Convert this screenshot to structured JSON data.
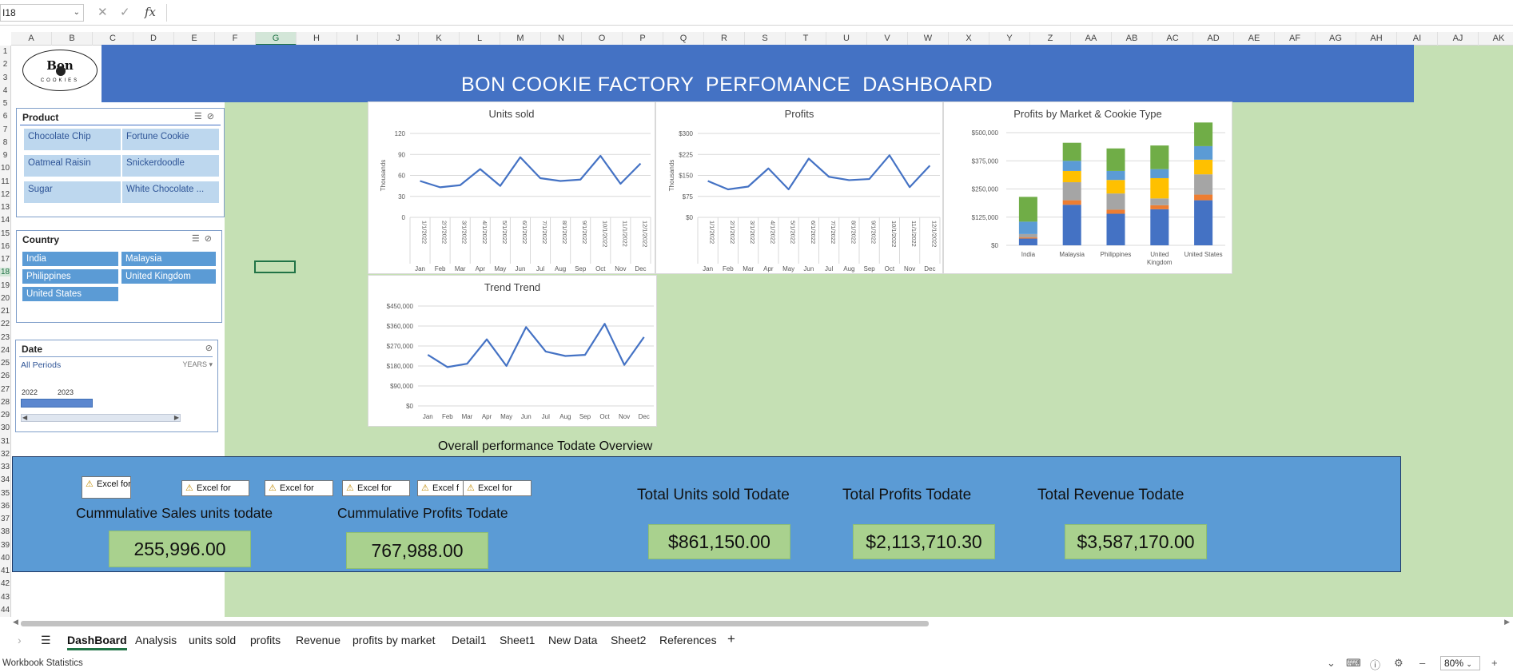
{
  "formula_bar": {
    "name_box": "I18",
    "cancel_icon": "cancel-icon",
    "enter_icon": "check-icon",
    "fx_label": "fx",
    "content": ""
  },
  "columns": [
    "A",
    "B",
    "C",
    "D",
    "E",
    "F",
    "G",
    "H",
    "I",
    "J",
    "K",
    "L",
    "M",
    "N",
    "O",
    "P",
    "Q",
    "R",
    "S",
    "T",
    "U",
    "V",
    "W",
    "X",
    "Y",
    "Z",
    "AA",
    "AB",
    "AC",
    "AD",
    "AE",
    "AF",
    "AG",
    "AH",
    "AI",
    "AJ",
    "AK"
  ],
  "rows": [
    "1",
    "2",
    "3",
    "4",
    "5",
    "6",
    "7",
    "8",
    "9",
    "10",
    "11",
    "12",
    "13",
    "14",
    "15",
    "16",
    "17",
    "18",
    "19",
    "20",
    "21",
    "22",
    "23",
    "24",
    "25",
    "26",
    "27",
    "28",
    "29",
    "30",
    "31",
    "32",
    "33",
    "34",
    "35",
    "36",
    "37",
    "38",
    "39",
    "40",
    "41",
    "42",
    "43",
    "44"
  ],
  "banner": {
    "title": "BON COOKIE FACTORY  PERFOMANCE  DASHBOARD"
  },
  "logo": {
    "line1": "Bon",
    "line2": "COOKIES"
  },
  "slicers": {
    "product": {
      "title": "Product",
      "items": [
        "Chocolate Chip",
        "Fortune Cookie",
        "Oatmeal Raisin",
        "Snickerdoodle",
        "Sugar",
        "White Chocolate ..."
      ]
    },
    "country": {
      "title": "Country",
      "items": [
        "India",
        "Malaysia",
        "Philippines",
        "United Kingdom",
        "United States"
      ]
    },
    "date": {
      "title": "Date",
      "periods": "All Periods",
      "level": "YEARS",
      "years": [
        "2022",
        "2023"
      ]
    }
  },
  "charts": {
    "months": [
      "Jan",
      "Feb",
      "Mar",
      "Apr",
      "May",
      "Jun",
      "Jul",
      "Aug",
      "Sep",
      "Oct",
      "Nov",
      "Dec"
    ],
    "dates": [
      "1/1/2022",
      "2/1/2022",
      "3/1/2022",
      "4/1/2022",
      "5/1/2022",
      "6/1/2022",
      "7/1/2022",
      "8/1/2022",
      "9/1/2022",
      "10/1/2022",
      "11/1/2022",
      "12/1/2022"
    ]
  },
  "chart_data": [
    {
      "type": "line",
      "title": "Units sold",
      "ylabel": "Thousands",
      "x": [
        "Jan",
        "Feb",
        "Mar",
        "Apr",
        "May",
        "Jun",
        "Jul",
        "Aug",
        "Sep",
        "Oct",
        "Nov",
        "Dec"
      ],
      "values": [
        52,
        43,
        46,
        69,
        45,
        86,
        56,
        52,
        54,
        88,
        48,
        77
      ],
      "ylim": [
        0,
        120
      ],
      "yticks": [
        "0",
        "30",
        "60",
        "90",
        "120"
      ],
      "color": "#4472c4"
    },
    {
      "type": "line",
      "title": "Profits",
      "ylabel": "Thousands",
      "x": [
        "Jan",
        "Feb",
        "Mar",
        "Apr",
        "May",
        "Jun",
        "Jul",
        "Aug",
        "Sep",
        "Oct",
        "Nov",
        "Dec"
      ],
      "values": [
        130,
        100,
        110,
        175,
        100,
        210,
        145,
        133,
        137,
        222,
        108,
        185
      ],
      "ylim": [
        0,
        300
      ],
      "yticks": [
        "$0",
        "$75",
        "$150",
        "$225",
        "$300"
      ],
      "color": "#4472c4"
    },
    {
      "type": "bar",
      "stacked": true,
      "title": "Profits by Market & Cookie Type",
      "categories": [
        "India",
        "Malaysia",
        "Philippines",
        "United Kingdom",
        "United States"
      ],
      "series": [
        {
          "values": [
            30000,
            180000,
            140000,
            160000,
            200000
          ],
          "color": "#4472c4"
        },
        {
          "values": [
            5000,
            20000,
            18000,
            18000,
            25000
          ],
          "color": "#ed7d31"
        },
        {
          "values": [
            15000,
            80000,
            72000,
            30000,
            90000
          ],
          "color": "#a5a5a5"
        },
        {
          "values": [
            0,
            50000,
            60000,
            90000,
            65000
          ],
          "color": "#ffc000"
        },
        {
          "values": [
            55000,
            45000,
            40000,
            40000,
            60000
          ],
          "color": "#5b9bd5"
        },
        {
          "values": [
            110000,
            80000,
            100000,
            105000,
            105000
          ],
          "color": "#70ad47"
        }
      ],
      "ylim": [
        0,
        500000
      ],
      "yticks": [
        "$0",
        "$125,000",
        "$250,000",
        "$375,000",
        "$500,000"
      ]
    },
    {
      "type": "line",
      "title": "Trend Trend",
      "x": [
        "Jan",
        "Feb",
        "Mar",
        "Apr",
        "May",
        "Jun",
        "Jul",
        "Aug",
        "Sep",
        "Oct",
        "Nov",
        "Dec"
      ],
      "values": [
        230000,
        175000,
        190000,
        300000,
        180000,
        355000,
        245000,
        225000,
        230000,
        370000,
        185000,
        310000
      ],
      "ylim": [
        0,
        450000
      ],
      "yticks": [
        "$0",
        "$90,000",
        "$180,000",
        "$270,000",
        "$360,000",
        "$450,000"
      ],
      "color": "#4472c4"
    }
  ],
  "performance": {
    "title": "Overall performance Todate Overview",
    "excel_chips": [
      "Excel for",
      "Excel for",
      "Excel for",
      "Excel for",
      "Excel f",
      "Excel for"
    ],
    "kpis": [
      {
        "label": "Cummulative Sales units todate",
        "value": "255,996.00"
      },
      {
        "label": "Cummulative Profits Todate",
        "value": "767,988.00"
      },
      {
        "label": "Total Units sold Todate",
        "value": "$861,150.00"
      },
      {
        "label": "Total Profits Todate",
        "value": "$2,113,710.30"
      },
      {
        "label": "Total Revenue Todate",
        "value": "$3,587,170.00"
      }
    ]
  },
  "sheet_tabs": [
    "DashBoard",
    "Analysis",
    "units sold",
    "profits",
    "Revenue",
    "profits by market",
    "Detail1",
    "Sheet1",
    "New Data",
    "Sheet2",
    "References"
  ],
  "active_tab": "DashBoard",
  "status": {
    "text": "Workbook Statistics",
    "zoom": "80%"
  }
}
